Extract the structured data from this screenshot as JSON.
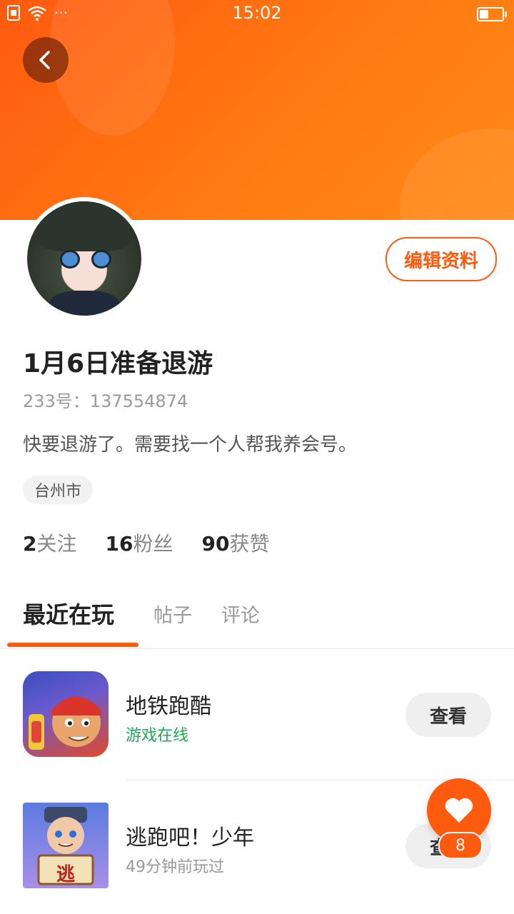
{
  "status_bar": {
    "time": "15:02",
    "signal_icon": "wifi-icon",
    "more": "···",
    "battery_level": 0.4
  },
  "profile": {
    "username": "1月6日准备退游",
    "id_text": "233号：137554874",
    "bio": "快要退游了。需要找一个人帮我养会号。",
    "location": "台州市",
    "edit_label": "编辑资料"
  },
  "stats": [
    {
      "num": "2",
      "label": "关注"
    },
    {
      "num": "16",
      "label": "粉丝"
    },
    {
      "num": "90",
      "label": "获赞"
    }
  ],
  "tabs": [
    "最近在玩",
    "帖子",
    "评论"
  ],
  "games": [
    {
      "name": "地铁跑酷",
      "status": "游戏在线",
      "status_color": "#1aaa55",
      "button": "查看"
    },
    {
      "name": "逃跑吧！少年",
      "status": "49分钟前玩过",
      "status_color": "#999999",
      "button": "查看",
      "icon_text": "逃"
    }
  ],
  "fab": {
    "icon": "heart-icon",
    "count": "8"
  },
  "colors": {
    "accent": "#ff5b0f"
  }
}
